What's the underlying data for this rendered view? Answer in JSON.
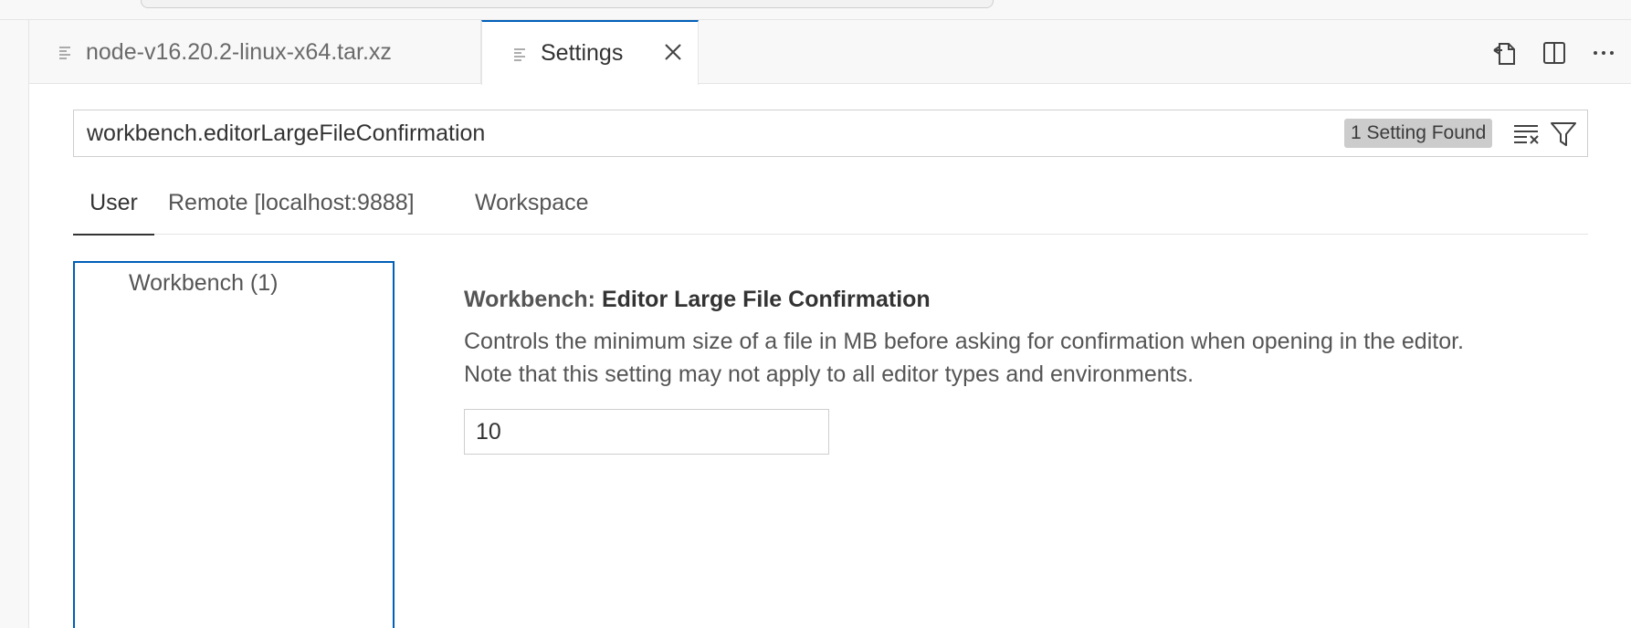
{
  "tabs": [
    {
      "label": "node-v16.20.2-linux-x64.tar.xz",
      "icon": "file-lines-icon"
    },
    {
      "label": "Settings",
      "icon": "file-lines-icon",
      "active": true
    }
  ],
  "editor_actions": [
    "open-settings-json-icon",
    "split-editor-icon",
    "more-actions-icon"
  ],
  "search": {
    "value": "workbench.editorLargeFileConfirmation",
    "results_badge": "1 Setting Found"
  },
  "scopes": {
    "user": "User",
    "remote": "Remote [localhost:9888]",
    "workspace": "Workspace"
  },
  "toc": {
    "items": [
      {
        "label": "Workbench (1)"
      }
    ]
  },
  "setting": {
    "category": "Workbench: ",
    "name": "Editor Large File Confirmation",
    "description_line1": "Controls the minimum size of a file in MB before asking for confirmation when opening in the editor.",
    "description_line2": "Note that this setting may not apply to all editor types and environments.",
    "value": "10"
  },
  "colors": {
    "accent": "#005fb8",
    "badge_bg": "#cccccc"
  }
}
